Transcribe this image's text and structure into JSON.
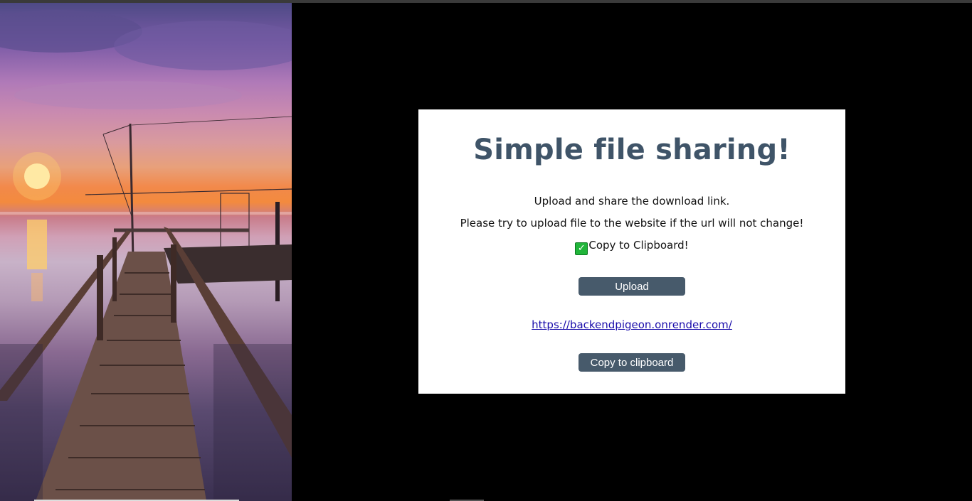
{
  "hero": {
    "image_alt": "Sunset over a wooden pier on calm water"
  },
  "card": {
    "title": "Simple file sharing!",
    "subtitle": "Upload and share the download link.",
    "instruction": "Please try to upload file to the website if the url will not change!",
    "copy_status_icon": "check-mark-icon",
    "copy_status": "Copy to Clipboard!",
    "upload_label": "Upload",
    "link_text": "https://backendpigeon.onrender.com/",
    "copy_button_label": "Copy to clipboard"
  },
  "colors": {
    "title": "#3f5468",
    "button": "#475a6b",
    "link": "#1a0dab",
    "check": "#21b53a"
  }
}
